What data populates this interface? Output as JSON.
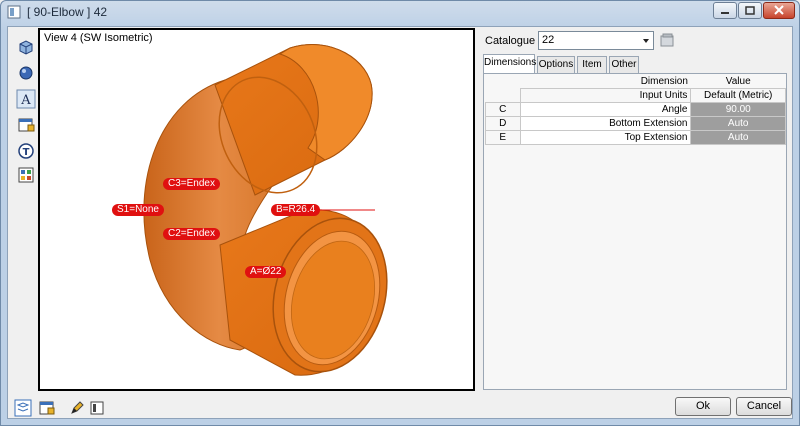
{
  "window": {
    "title": "[ 90-Elbow ]  42"
  },
  "viewport": {
    "label": "View 4 (SW Isometric)",
    "dimension_tags": {
      "c3": "C3=Endex",
      "s1": "S1=None",
      "b": "B=R26.4",
      "c2": "C2=Endex",
      "a": "A=Ø22"
    },
    "colors": {
      "pipe": "#e07a1f",
      "pipe_dark": "#b85a0c",
      "tag": "#e01010"
    }
  },
  "catalogue": {
    "label": "Catalogue",
    "value": "22"
  },
  "tabs": [
    {
      "label": "Dimensions",
      "active": true
    },
    {
      "label": "Options",
      "active": false
    },
    {
      "label": "Item",
      "active": false
    },
    {
      "label": "Other",
      "active": false
    }
  ],
  "table": {
    "header_dimension": "Dimension",
    "header_value": "Value",
    "subheader_dimension": "Input Units",
    "subheader_value": "Default (Metric)",
    "rows": [
      {
        "key": "C",
        "dimension": "Angle",
        "value": "90.00"
      },
      {
        "key": "D",
        "dimension": "Bottom Extension",
        "value": "Auto"
      },
      {
        "key": "E",
        "dimension": "Top Extension",
        "value": "Auto"
      }
    ]
  },
  "buttons": {
    "ok": "Ok",
    "cancel": "Cancel"
  }
}
